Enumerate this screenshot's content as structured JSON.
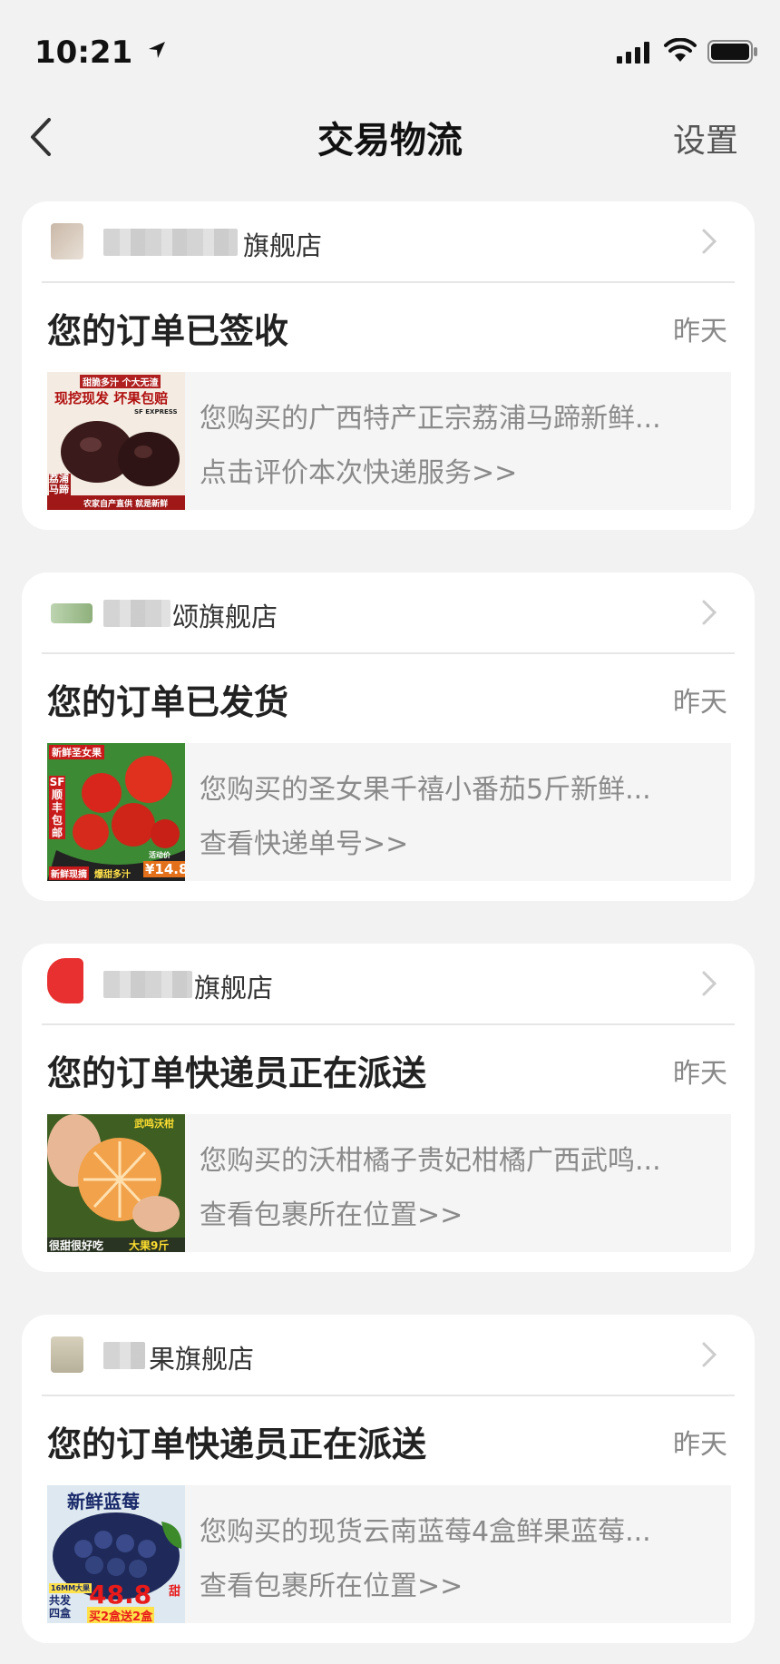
{
  "status_bar": {
    "time": "10:21"
  },
  "nav": {
    "title": "交易物流",
    "settings": "设置"
  },
  "orders": [
    {
      "shop_suffix": "旗舰店",
      "status": "您的订单已签收",
      "time": "昨天",
      "desc": "您购买的广西特产正宗荔浦马蹄新鲜...",
      "action": "点击评价本次快递服务>>",
      "thumb": {
        "top_text": "甜脆多汁 个大无渣",
        "banner": "现挖现发 坏果包赔",
        "badge": "SF EXPRESS",
        "corner": "荔浦马蹄",
        "bottom": "农家自产直供 就是新鲜"
      }
    },
    {
      "shop_suffix": "颂旗舰店",
      "status": "您的订单已发货",
      "time": "昨天",
      "desc": "您购买的圣女果千禧小番茄5斤新鲜...",
      "action": "查看快递单号>>",
      "thumb": {
        "top_text": "新鲜圣女果",
        "side": "SF顺丰包邮",
        "bottom_left": "新鲜现摘",
        "bottom_mid": "爆甜多汁",
        "price_label": "活动价",
        "price": "¥14.8"
      }
    },
    {
      "shop_suffix": "旗舰店",
      "status": "您的订单快递员正在派送",
      "time": "昨天",
      "desc": "您购买的沃柑橘子贵妃柑橘广西武鸣...",
      "action": "查看包裹所在位置>>",
      "thumb": {
        "top_text": "武鸣沃柑",
        "bottom_left": "很甜很好吃",
        "bottom_right": "大果9斤"
      }
    },
    {
      "shop_suffix": "果旗舰店",
      "status": "您的订单快递员正在派送",
      "time": "昨天",
      "desc": "您购买的现货云南蓝莓4盒鲜果蓝莓...",
      "action": "查看包裹所在位置>>",
      "thumb": {
        "top_text": "新鲜蓝莓",
        "size": "16MM大果",
        "count": "共发四盒",
        "price": "48.8",
        "sweet": "甜",
        "promo": "买2盒送2盒"
      }
    }
  ],
  "colors": {
    "background": "#f2f2f2",
    "card": "#ffffff",
    "detail_bg": "#f5f5f5",
    "muted_text": "#8a8a8a"
  }
}
